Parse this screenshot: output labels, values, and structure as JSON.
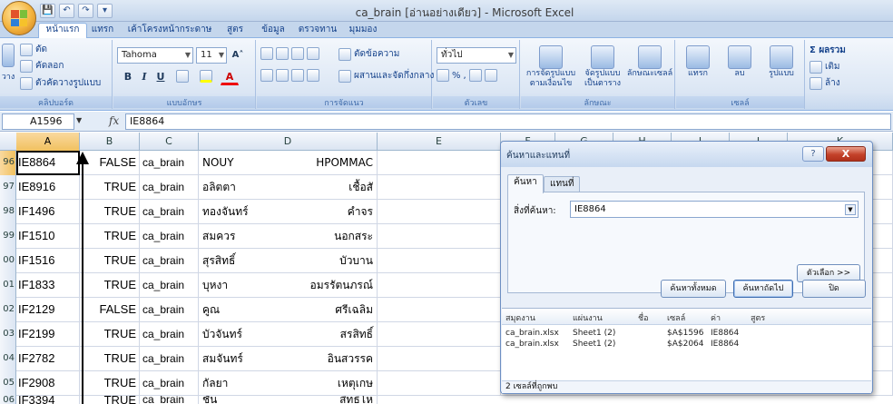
{
  "window": {
    "title": "ca_brain  [อ่านอย่างเดียว] - Microsoft Excel"
  },
  "qat": {
    "save": "💾",
    "undo": "↶",
    "redo": "↷",
    "more": "▾"
  },
  "tabs": [
    "หน้าแรก",
    "แทรก",
    "เค้าโครงหน้ากระดาษ",
    "สูตร",
    "ข้อมูล",
    "ตรวจทาน",
    "มุมมอง"
  ],
  "ribbon": {
    "clipboard": {
      "cut": "ตัด",
      "copy": "คัดลอก",
      "format_painter": "ตัวคัดวางรูปแบบ",
      "paste": "วาง",
      "label": "คลิปบอร์ด"
    },
    "font": {
      "name": "Tahoma",
      "size": "11",
      "grow": "A˄",
      "shrink": "A˅",
      "bold": "B",
      "italic": "I",
      "underline": "U",
      "label": "แบบอักษร"
    },
    "alignment": {
      "wrap": "ตัดข้อความ",
      "merge": "ผสานและจัดกึ่งกลาง",
      "label": "การจัดแนว"
    },
    "number": {
      "format": "ทั่วไป",
      "percent": "%",
      "comma": ",",
      "label": "ตัวเลข"
    },
    "styles": {
      "conditional": "การจัดรูปแบบตามเงื่อนไข",
      "table": "จัดรูปแบบเป็นตาราง",
      "cell": "ลักษณะเซลล์",
      "label": "ลักษณะ"
    },
    "cells": {
      "insert": "แทรก",
      "delete": "ลบ",
      "format": "รูปแบบ",
      "label": "เซลล์"
    },
    "editing": {
      "autosum": "Σ ผลรวม",
      "fill": "เติม",
      "clear": "ล้าง"
    }
  },
  "formula_bar": {
    "name_box": "A1596",
    "fx": "fx",
    "value": "IE8864"
  },
  "columns": [
    "A",
    "B",
    "C",
    "D",
    "E",
    "F",
    "G",
    "H",
    "I",
    "J",
    "K"
  ],
  "rows": [
    {
      "num": "96",
      "a": "IE8864",
      "b": "FALSE",
      "c": "ca_brain",
      "first": "NOUY",
      "last": "HPOMMAC"
    },
    {
      "num": "97",
      "a": "IE8916",
      "b": "TRUE",
      "c": "ca_brain",
      "first": "อลิตตา",
      "last": "เชื้อสั"
    },
    {
      "num": "98",
      "a": "IF1496",
      "b": "TRUE",
      "c": "ca_brain",
      "first": "ทองจันทร์",
      "last": "คำจร"
    },
    {
      "num": "99",
      "a": "IF1510",
      "b": "TRUE",
      "c": "ca_brain",
      "first": "สมควร",
      "last": "นอกสระ"
    },
    {
      "num": "00",
      "a": "IF1516",
      "b": "TRUE",
      "c": "ca_brain",
      "first": "สุรสิทธิ์",
      "last": "บัวบาน"
    },
    {
      "num": "01",
      "a": "IF1833",
      "b": "TRUE",
      "c": "ca_brain",
      "first": "บุหงา",
      "last": "อมรรัตนภรณ์"
    },
    {
      "num": "02",
      "a": "IF2129",
      "b": "FALSE",
      "c": "ca_brain",
      "first": "คูณ",
      "last": "ศรีเฉลิม"
    },
    {
      "num": "03",
      "a": "IF2199",
      "b": "TRUE",
      "c": "ca_brain",
      "first": "บัวจันทร์",
      "last": "สรสิทธิ์"
    },
    {
      "num": "04",
      "a": "IF2782",
      "b": "TRUE",
      "c": "ca_brain",
      "first": "สมจันทร์",
      "last": "อินสวรรค"
    },
    {
      "num": "05",
      "a": "IF2908",
      "b": "TRUE",
      "c": "ca_brain",
      "first": "กัลยา",
      "last": "เหตุเกษ"
    },
    {
      "num": "06",
      "a": "IF3394",
      "b": "TRUE",
      "c": "ca_brain",
      "first": "ชั้น",
      "last": "สิทธิโห"
    }
  ],
  "dialog": {
    "title": "ค้นหาและแทนที่",
    "help": "?",
    "close": "X",
    "tab_find": "ค้นหา",
    "tab_replace": "แทนที่",
    "find_label": "สิ่งที่ค้นหา:",
    "find_value": "IE8864",
    "options_button": "ตัวเลือก >>",
    "find_all_button": "ค้นหาทั้งหมด",
    "find_next_button": "ค้นหาถัดไป",
    "close_button": "ปิด",
    "results_headers": [
      "สมุดงาน",
      "แผ่นงาน",
      "ชื่อ",
      "เซลล์",
      "ค่า",
      "สูตร"
    ],
    "results": [
      {
        "book": "ca_brain.xlsx",
        "sheet": "Sheet1 (2)",
        "cell": "$A$1596",
        "value": "IE8864"
      },
      {
        "book": "ca_brain.xlsx",
        "sheet": "Sheet1 (2)",
        "cell": "$A$2064",
        "value": "IE8864"
      }
    ],
    "status": "2 เซลล์ที่ถูกพบ"
  }
}
